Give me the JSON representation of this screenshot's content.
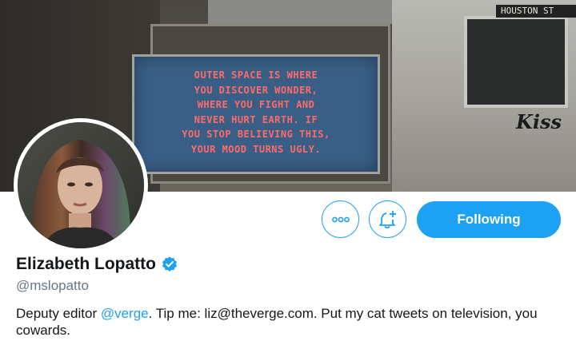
{
  "banner": {
    "board_lines": [
      "OUTER SPACE IS WHERE",
      "YOU DISCOVER WONDER,",
      "WHERE YOU FIGHT AND",
      "NEVER HURT EARTH. IF",
      "YOU STOP BELIEVING THIS,",
      "YOUR MOOD TURNS UGLY."
    ],
    "bus_sign": "HOUSTON ST",
    "bus_logo": "Kiss"
  },
  "profile": {
    "name": "Elizabeth Lopatto",
    "handle": "@mslopatto",
    "verified": true,
    "bio": {
      "before": "Deputy editor ",
      "mention": "@verge",
      "after": ". Tip me: liz@theverge.com. Put my cat tweets on television, you cowards."
    }
  },
  "actions": {
    "more_icon": "ellipsis-icon",
    "notify_icon": "bell-plus-icon",
    "follow_label": "Following"
  },
  "colors": {
    "accent": "#1da1f2",
    "text": "#14171a",
    "secondary": "#657786"
  }
}
